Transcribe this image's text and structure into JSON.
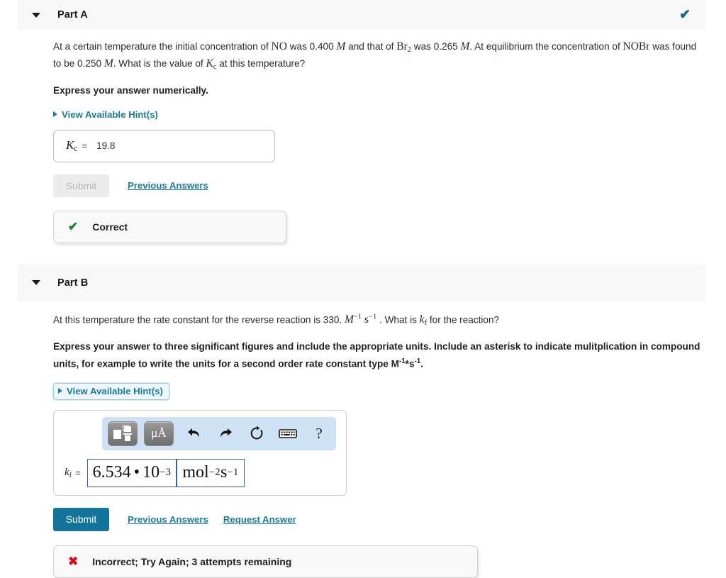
{
  "parts": {
    "a": {
      "title": "Part A",
      "status_icon": "check-icon",
      "question": {
        "prefix": "At a certain temperature the initial concentration of ",
        "species1": "NO",
        "mid1": " was 0.400 ",
        "unit1": "M",
        "mid2": " and that of ",
        "species2": "Br",
        "species2_sub": "2",
        "mid3": " was 0.265 ",
        "unit2": "M",
        "mid4": ". At equilibrium the concentration of ",
        "species3": "NOBr",
        "mid5": " was found to be 0.250 ",
        "unit3": "M",
        "mid6": ". What is the value of ",
        "symbol": "K",
        "symbol_sub": "c",
        "suffix": " at this temperature?"
      },
      "instruction": "Express your answer numerically.",
      "hint_label": "View Available Hint(s)",
      "answer": {
        "label": "K",
        "label_sub": "c",
        "equals": "=",
        "value": "19.8"
      },
      "submit_label": "Submit",
      "previous_answers_label": "Previous Answers",
      "feedback": {
        "icon": "check-icon",
        "text": "Correct"
      }
    },
    "b": {
      "title": "Part B",
      "question": {
        "prefix": "At this temperature the rate constant for the reverse reaction is 330. ",
        "unit_m": "M",
        "unit_m_exp": "−1",
        "unit_s": "s",
        "unit_s_exp": "−1",
        "mid": " . What is ",
        "symbol": "k",
        "symbol_sub": "f",
        "suffix": " for the reaction?"
      },
      "instruction_line1": "Express your answer to three significant figures and include the appropriate units. Include an asterisk to indicate mulitplication in",
      "instruction_line2_pre": "compound units, for example to write the units for a second order rate constant type M",
      "instruction_exp1": "-1",
      "instruction_mid": "*s",
      "instruction_exp2": "-1",
      "instruction_end": ".",
      "hint_label": "View Available Hint(s)",
      "toolbar": {
        "template_button": "template-icon",
        "units_button": "μÅ",
        "undo_button": "undo-icon",
        "redo_button": "redo-icon",
        "reset_button": "reset-icon",
        "keyboard_button": "keyboard-icon",
        "help_button": "?"
      },
      "answer": {
        "label": "k",
        "label_sub": "f",
        "equals": "=",
        "value_mantissa": "6.534",
        "value_dot": "•",
        "value_base": "10",
        "value_exp": "−3",
        "units_mol": "mol",
        "units_mol_exp": "−2",
        "units_s": "s",
        "units_s_exp": "−1"
      },
      "submit_label": "Submit",
      "previous_answers_label": "Previous Answers",
      "request_answer_label": "Request Answer",
      "feedback": {
        "icon": "x-icon",
        "text": "Incorrect; Try Again; 3 attempts remaining"
      }
    }
  },
  "colors": {
    "link": "#1a7b9e",
    "submit_active": "#12749a",
    "correct_green": "#15803d",
    "incorrect_red": "#d41020",
    "header_bg": "#f8f8f8",
    "toolbar_bg": "#cfe2f5",
    "mathfield_border": "#3a5fa8"
  },
  "glyphs": {
    "check": "✔",
    "cross": "✖",
    "undo": "⬅",
    "redo": "➡",
    "reset": "↻",
    "keyboard": "⌨"
  }
}
